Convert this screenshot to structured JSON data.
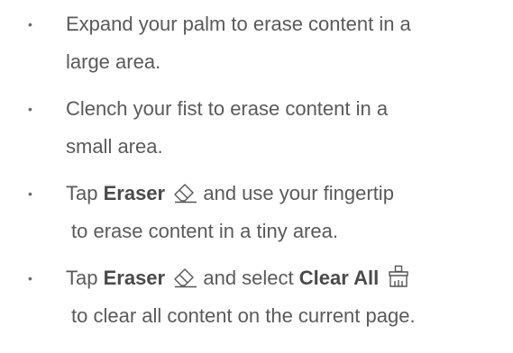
{
  "bullet_char": "•",
  "items": [
    {
      "line1": "Expand your palm to erase content in a",
      "line2": "large area."
    },
    {
      "line1": "Clench your fist to erase content in a",
      "line2": "small area."
    },
    {
      "pre": "Tap ",
      "bold1": "Eraser",
      "icon1": "eraser-icon",
      "post": " and use your fingertip",
      "line2": "to erase content in a tiny area."
    },
    {
      "pre": "Tap ",
      "bold1": "Eraser",
      "icon1": "eraser-icon",
      "mid": " and select ",
      "bold2": "Clear All",
      "icon2": "broom-icon",
      "line2": "to clear all content on the current page."
    }
  ]
}
